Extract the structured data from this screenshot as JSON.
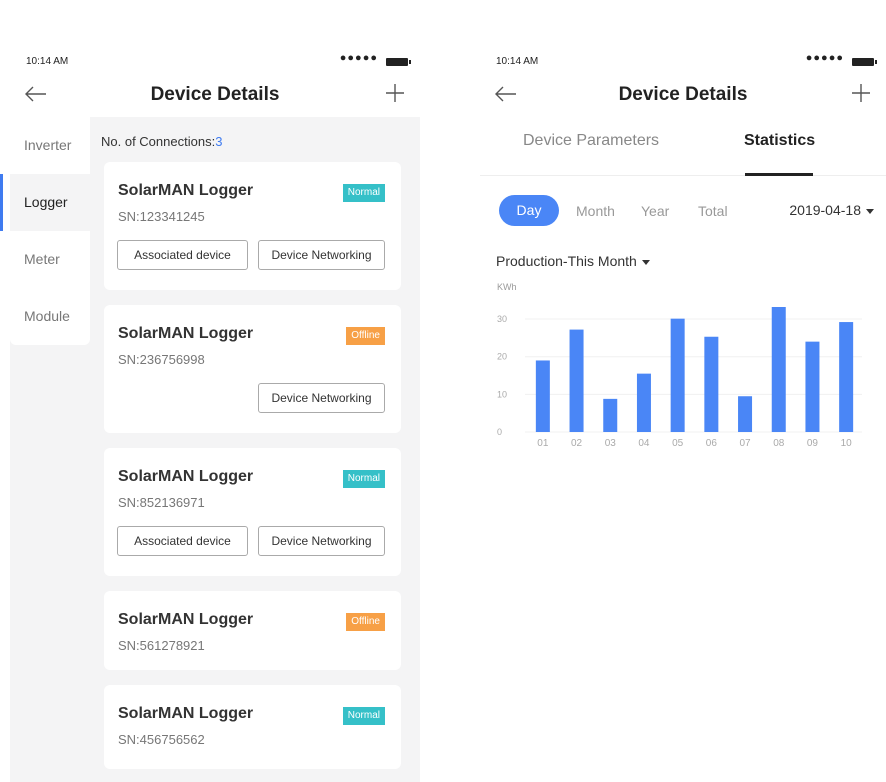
{
  "status_bar": {
    "time": "10:14 AM",
    "signal": "●●●●●"
  },
  "nav": {
    "title": "Device Details"
  },
  "left": {
    "side_menu": [
      {
        "label": "Inverter",
        "active": false
      },
      {
        "label": "Logger",
        "active": true
      },
      {
        "label": "Meter",
        "active": false
      },
      {
        "label": "Module",
        "active": false
      }
    ],
    "connections_label": "No. of Connections:",
    "connections_count": "3",
    "associated_label": "Associated device",
    "networking_label": "Device Networking",
    "devices": [
      {
        "name": "SolarMAN  Logger",
        "sn": "SN:123341245",
        "status": "Normal",
        "buttons": [
          "associated",
          "networking"
        ]
      },
      {
        "name": "SolarMAN  Logger",
        "sn": "SN:236756998",
        "status": "Offline",
        "buttons": [
          "networking"
        ]
      },
      {
        "name": "SolarMAN  Logger",
        "sn": "SN:852136971",
        "status": "Normal",
        "buttons": [
          "associated",
          "networking"
        ]
      },
      {
        "name": "SolarMAN  Logger",
        "sn": "SN:561278921",
        "status": "Offline",
        "buttons": []
      },
      {
        "name": "SolarMAN  Logger",
        "sn": "SN:456756562",
        "status": "Normal",
        "buttons": []
      }
    ]
  },
  "right": {
    "tabs": [
      {
        "label": "Device Parameters",
        "active": false
      },
      {
        "label": "Statistics",
        "active": true
      }
    ],
    "periods": {
      "day": "Day",
      "month": "Month",
      "year": "Year",
      "total": "Total"
    },
    "date": "2019-04-18",
    "production_select": "Production-This Month",
    "unit": "KWh"
  },
  "colors": {
    "accent": "#4a86f6",
    "normal": "#35c0c8",
    "offline": "#f7a046",
    "bar": "#4a86f6"
  },
  "chart_data": {
    "type": "bar",
    "categories": [
      "01",
      "02",
      "03",
      "04",
      "05",
      "06",
      "07",
      "08",
      "09",
      "10"
    ],
    "values": [
      19,
      27.2,
      8.8,
      15.5,
      30.1,
      25.3,
      9.5,
      33.2,
      24,
      29.2
    ],
    "ylabel": "KWh",
    "yticks": [
      0,
      10,
      20,
      30
    ],
    "ylim": [
      0,
      33.2
    ],
    "grid": true
  }
}
